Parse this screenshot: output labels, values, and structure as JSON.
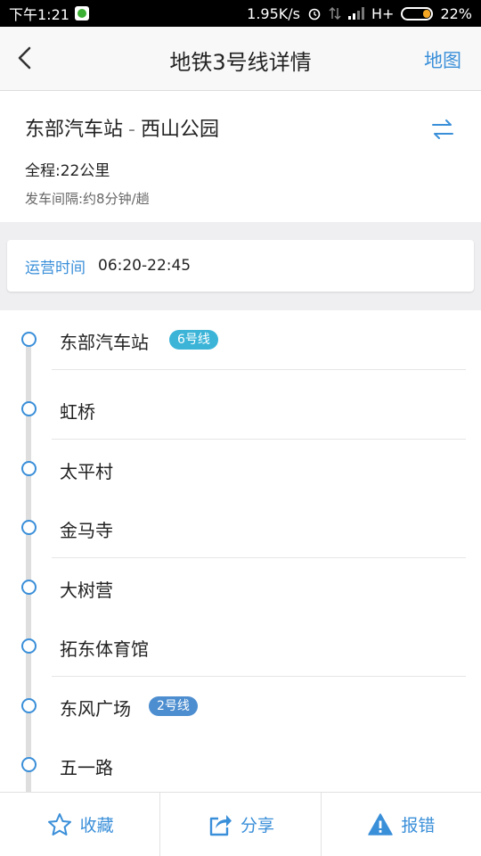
{
  "status_bar": {
    "time": "下午1:21",
    "speed": "1.95K/s",
    "network": "H+",
    "battery": "22%"
  },
  "header": {
    "title": "地铁3号线详情",
    "map_label": "地图"
  },
  "route": {
    "from": "东部汽车站",
    "separator": "-",
    "to": "西山公园",
    "distance": "全程:22公里",
    "interval": "发车间隔:约8分钟/趟"
  },
  "operation": {
    "label": "运营时间",
    "hours": "06:20-22:45"
  },
  "stations": [
    {
      "name": "东部汽车站",
      "transfer": "6号线",
      "transfer_color": "#3bb4d8"
    },
    {
      "name": "虹桥"
    },
    {
      "name": "太平村"
    },
    {
      "name": "金马寺"
    },
    {
      "name": "大树营"
    },
    {
      "name": "拓东体育馆"
    },
    {
      "name": "东风广场",
      "transfer": "2号线",
      "transfer_color": "#4d8ed0"
    },
    {
      "name": "五一路"
    }
  ],
  "toolbar": {
    "favorite_label": "收藏",
    "share_label": "分享",
    "report_label": "报错"
  },
  "colors": {
    "accent": "#3a8fd9",
    "line6": "#3bb4d8",
    "line2": "#4d8ed0"
  }
}
